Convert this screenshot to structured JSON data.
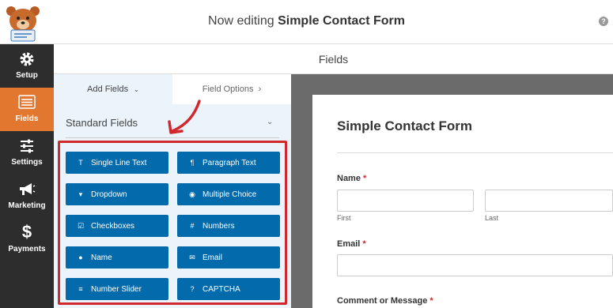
{
  "header": {
    "title_prefix": "Now editing",
    "form_name": "Simple Contact Form",
    "help": "?"
  },
  "sidebar": {
    "items": [
      {
        "label": "Setup",
        "icon": "gear-icon"
      },
      {
        "label": "Fields",
        "icon": "list-icon",
        "active": true
      },
      {
        "label": "Settings",
        "icon": "sliders-icon"
      },
      {
        "label": "Marketing",
        "icon": "megaphone-icon"
      },
      {
        "label": "Payments",
        "icon": "dollar-icon"
      }
    ]
  },
  "fieldsbar": {
    "label": "Fields"
  },
  "panel": {
    "tabs": {
      "add": "Add Fields",
      "options": "Field Options"
    },
    "section": "Standard Fields",
    "buttons": [
      {
        "label": "Single Line Text",
        "icon": "text-icon"
      },
      {
        "label": "Paragraph Text",
        "icon": "paragraph-icon"
      },
      {
        "label": "Dropdown",
        "icon": "dropdown-icon"
      },
      {
        "label": "Multiple Choice",
        "icon": "radio-icon"
      },
      {
        "label": "Checkboxes",
        "icon": "checkbox-icon"
      },
      {
        "label": "Numbers",
        "icon": "hash-icon"
      },
      {
        "label": "Name",
        "icon": "user-icon"
      },
      {
        "label": "Email",
        "icon": "envelope-icon"
      },
      {
        "label": "Number Slider",
        "icon": "slider-icon"
      },
      {
        "label": "CAPTCHA",
        "icon": "question-icon"
      }
    ]
  },
  "preview": {
    "title": "Simple Contact Form",
    "name_label": "Name",
    "first": "First",
    "last": "Last",
    "email_label": "Email",
    "comment_label": "Comment or Message",
    "required_mark": "*"
  },
  "colors": {
    "accent": "#e27730",
    "button": "#036aab",
    "highlight": "#d0292d",
    "sidebar": "#2d2d2d"
  }
}
